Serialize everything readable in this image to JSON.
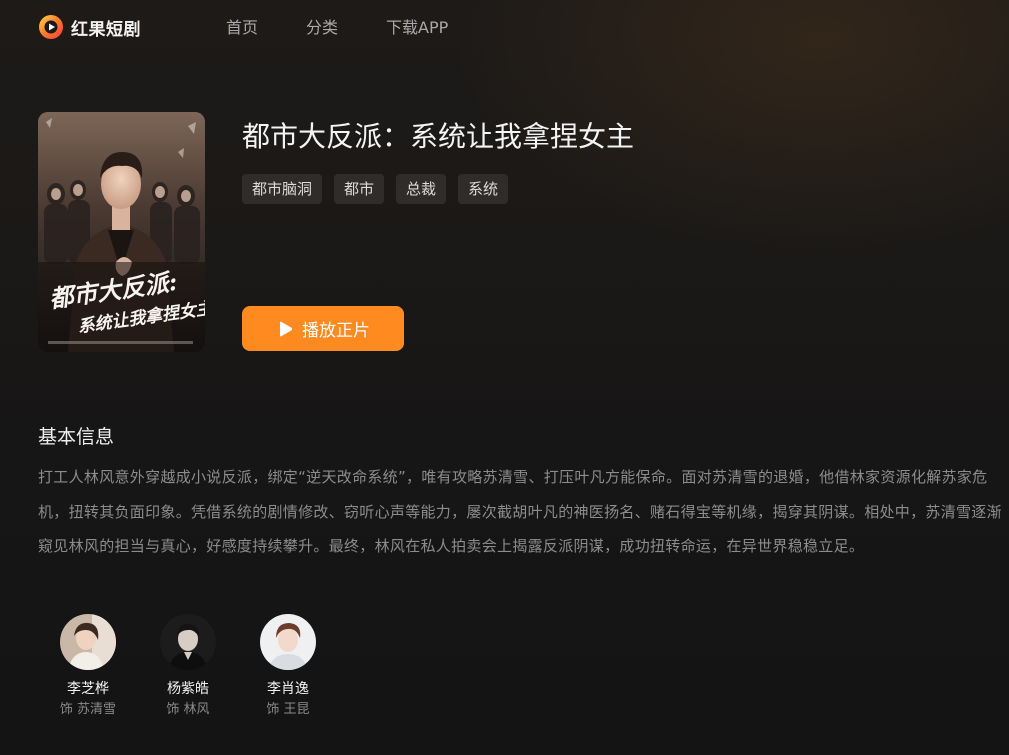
{
  "header": {
    "logo_text": "红果短剧",
    "nav": [
      "首页",
      "分类",
      "下载APP"
    ]
  },
  "drama": {
    "title": "都市大反派：系统让我拿捏女主",
    "tags": [
      "都市脑洞",
      "都市",
      "总裁",
      "系统"
    ],
    "play_label": "播放正片",
    "poster_text": "都市大反派：系统让我拿捏女主"
  },
  "info": {
    "section_title": "基本信息",
    "description": "打工人林风意外穿越成小说反派，绑定“逆天改命系统”，唯有攻略苏清雪、打压叶凡方能保命。面对苏清雪的退婚，他借林家资源化解苏家危机，扭转其负面印象。凭借系统的剧情修改、窃听心声等能力，屡次截胡叶凡的神医扬名、赌石得宝等机缘，揭穿其阴谋。相处中，苏清雪逐渐窥见林风的担当与真心，好感度持续攀升。最终，林风在私人拍卖会上揭露反派阴谋，成功扭转命运，在异世界稳稳立足。"
  },
  "cast": [
    {
      "name": "李芝桦",
      "role": "饰 苏清雪"
    },
    {
      "name": "杨紫皓",
      "role": "饰 林风"
    },
    {
      "name": "李肖逸",
      "role": "饰 王昆"
    }
  ],
  "colors": {
    "accent": "#ff8a1f",
    "tag_bg": "#302c2a",
    "muted_text": "#8c8c8c"
  }
}
